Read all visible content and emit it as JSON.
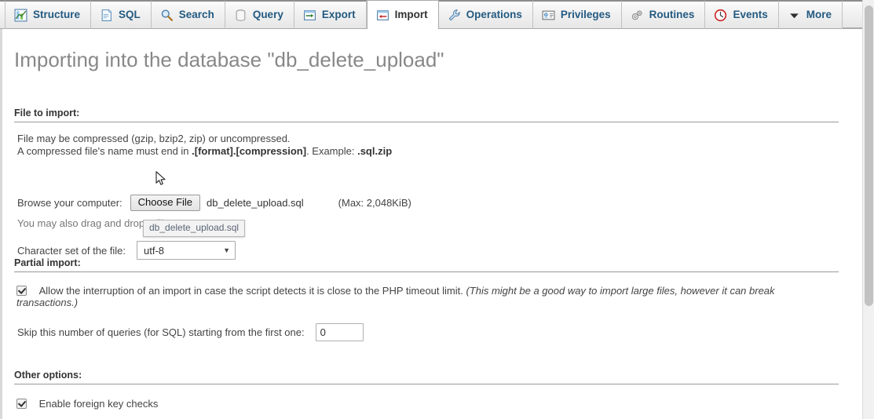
{
  "tabs": [
    {
      "label": "Structure",
      "icon": "structure-icon",
      "active": false
    },
    {
      "label": "SQL",
      "icon": "sql-icon",
      "active": false
    },
    {
      "label": "Search",
      "icon": "search-icon",
      "active": false
    },
    {
      "label": "Query",
      "icon": "query-icon",
      "active": false
    },
    {
      "label": "Export",
      "icon": "export-icon",
      "active": false
    },
    {
      "label": "Import",
      "icon": "import-icon",
      "active": true
    },
    {
      "label": "Operations",
      "icon": "wrench-icon",
      "active": false
    },
    {
      "label": "Privileges",
      "icon": "privileges-icon",
      "active": false
    },
    {
      "label": "Routines",
      "icon": "routines-icon",
      "active": false
    },
    {
      "label": "Events",
      "icon": "clock-icon",
      "active": false
    },
    {
      "label": "More",
      "icon": "chevron-down-icon",
      "active": false
    }
  ],
  "page": {
    "title": "Importing into the database \"db_delete_upload\""
  },
  "file_to_import": {
    "heading": "File to import:",
    "compression_note_line1": "File may be compressed (gzip, bzip2, zip) or uncompressed.",
    "compression_note_line2_prefix": "A compressed file's name must end in ",
    "compression_note_format": ".[format].[compression]",
    "compression_note_middle": ". Example: ",
    "compression_note_example": ".sql.zip",
    "browse_label": "Browse your computer:",
    "choose_file_button": "Choose File",
    "selected_file_name": "db_delete_upload.sql",
    "max_size": "(Max: 2,048KiB)",
    "drag_drop_note": "You may also drag and drop a file on any page",
    "tooltip_text": "db_delete_upload.sql",
    "charset_label": "Character set of the file:",
    "charset_value": "utf-8",
    "charset_caret": "▼"
  },
  "partial_import": {
    "heading": "Partial import:",
    "allow_interrupt_label": "Allow the interruption of an import in case the script detects it is close to the PHP timeout limit. ",
    "allow_interrupt_hint": "(This might be a good way to import large files, however it can break transactions.)",
    "allow_interrupt_checked": true,
    "skip_queries_label": "Skip this number of queries (for SQL) starting from the first one:",
    "skip_queries_value": "0"
  },
  "other_options": {
    "heading": "Other options:",
    "foreign_key_label": "Enable foreign key checks",
    "foreign_key_checked": true
  },
  "colors": {
    "tab_link": "#235a81",
    "title_grey": "#888888",
    "body_text": "#444444",
    "rule": "#999999"
  }
}
